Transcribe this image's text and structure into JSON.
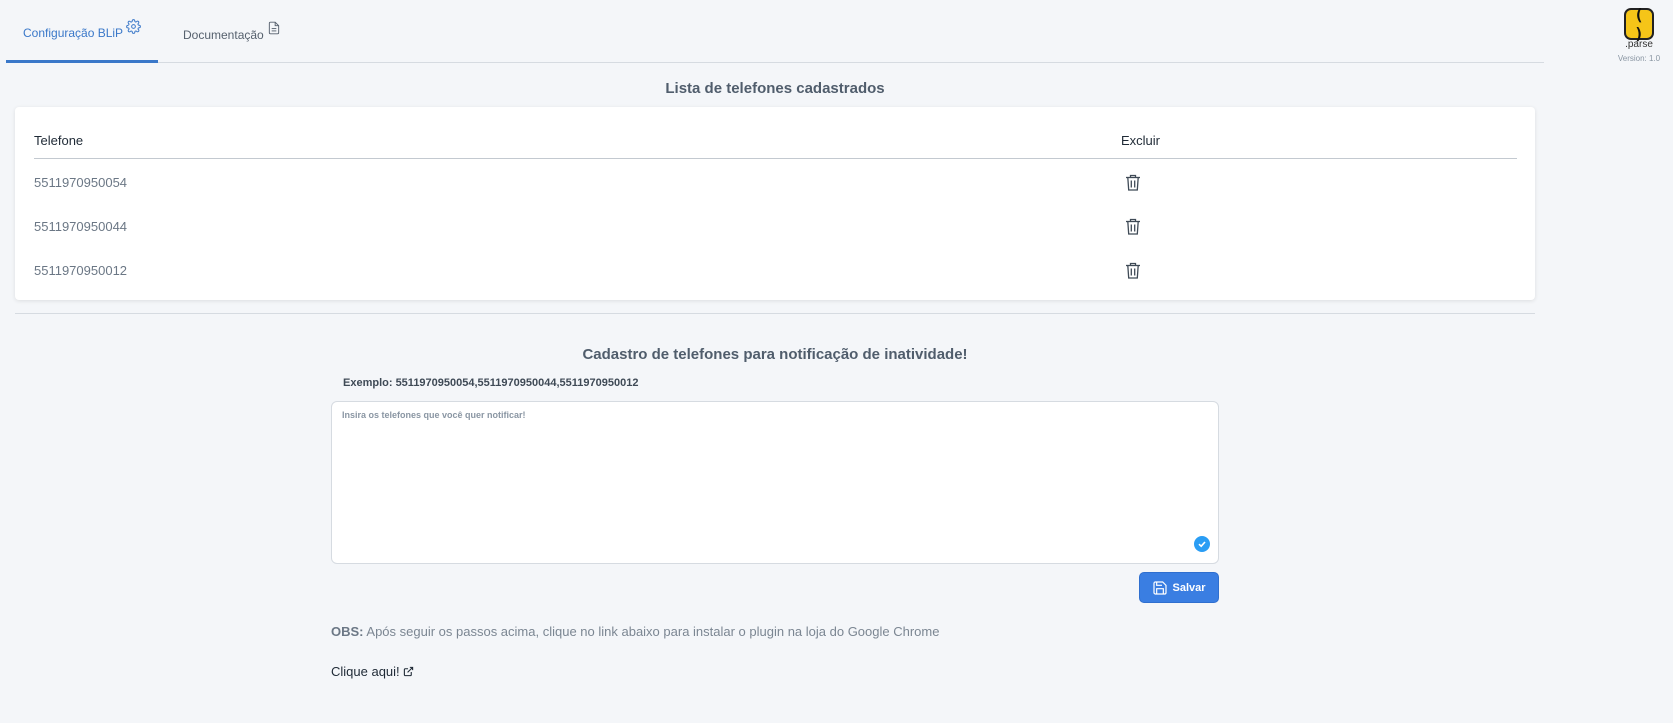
{
  "tabs": [
    {
      "label": "Configuração BLiP",
      "icon": "gear-icon",
      "active": true
    },
    {
      "label": "Documentação",
      "icon": "document-icon",
      "active": false
    }
  ],
  "brand": {
    "name": ".parse",
    "version": "Version: 1.0",
    "color": "#f5c518"
  },
  "phone_list": {
    "title": "Lista de telefones cadastrados",
    "columns": [
      "Telefone",
      "Excluir"
    ],
    "rows": [
      {
        "phone": "5511970950054"
      },
      {
        "phone": "5511970950044"
      },
      {
        "phone": "5511970950012"
      }
    ]
  },
  "register": {
    "title": "Cadastro de telefones para notificação de inatividade!",
    "example": "Exemplo: 5511970950054,5511970950044,5511970950012",
    "textarea_placeholder": "Insira os telefones que você quer notificar!",
    "textarea_value": "",
    "save_label": "Salvar"
  },
  "note": {
    "prefix": "OBS:",
    "text": "Após seguir os passos acima, clique no link abaixo para instalar o plugin na loja do Google Chrome"
  },
  "link": {
    "label": "Clique aqui!"
  },
  "colors": {
    "accent": "#3a78c9",
    "button": "#3a7ee2",
    "background": "#f4f6f9"
  }
}
